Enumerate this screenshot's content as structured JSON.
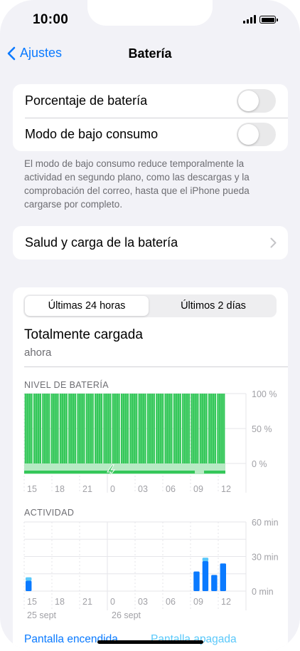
{
  "status": {
    "time": "10:00"
  },
  "nav": {
    "back_label": "Ajustes",
    "title": "Batería"
  },
  "settings": {
    "battery_percentage": {
      "label": "Porcentaje de batería",
      "on": false
    },
    "low_power": {
      "label": "Modo de bajo consumo",
      "on": false
    },
    "low_power_note": "El modo de bajo consumo reduce temporalmente la actividad en segundo plano, como las descargas y la comprobación del correo, hasta que el iPhone pueda cargarse por completo.",
    "health": {
      "label": "Salud y carga de la batería"
    }
  },
  "usage": {
    "tabs": [
      {
        "label": "Últimas 24 horas",
        "selected": true
      },
      {
        "label": "Últimos 2 días",
        "selected": false
      }
    ],
    "charge_status": "Totalmente cargada",
    "charge_time": "ahora",
    "battery_level_label": "NIVEL DE BATERÍA",
    "activity_label": "ACTIVIDAD",
    "dates": [
      "25 sept",
      "26 sept"
    ],
    "legend": {
      "screen_on": "Pantalla encendida",
      "screen_off": "Pantalla apagada"
    }
  },
  "colors": {
    "accent": "#0a7aff",
    "battery_green": "#34c759",
    "charging_green": "#b7eac4",
    "activity_dark": "#0a7aff",
    "activity_light": "#5ac8fa"
  },
  "chart_data": [
    {
      "type": "bar",
      "title": "NIVEL DE BATERÍA",
      "x_ticks": [
        "15",
        "18",
        "21",
        "0",
        "03",
        "06",
        "09",
        "12"
      ],
      "y_ticks": [
        "100 %",
        "50 %",
        "0 %"
      ],
      "ylim": [
        0,
        100
      ],
      "hour_count": 23,
      "values": [
        100,
        100,
        100,
        100,
        100,
        100,
        100,
        100,
        100,
        100,
        100,
        100,
        100,
        100,
        100,
        100,
        100,
        100,
        100,
        100,
        100,
        100,
        100
      ],
      "grid": true
    },
    {
      "type": "bar",
      "title": "ACTIVIDAD",
      "x_ticks": [
        "15",
        "18",
        "21",
        "0",
        "03",
        "06",
        "09",
        "12"
      ],
      "y_ticks": [
        "60 min",
        "30 min",
        "0 min"
      ],
      "ylim": [
        0,
        60
      ],
      "series": [
        {
          "name": "Pantalla encendida",
          "values": [
            9,
            0,
            0,
            0,
            0,
            0,
            0,
            0,
            0,
            0,
            0,
            0,
            0,
            0,
            0,
            0,
            0,
            0,
            0,
            17,
            26,
            14,
            24
          ]
        },
        {
          "name": "Pantalla apagada",
          "values": [
            3,
            0,
            0,
            0,
            0,
            0,
            0,
            0,
            0,
            0,
            0,
            0,
            0,
            0,
            0,
            0,
            0,
            0,
            0,
            0,
            3,
            0,
            0
          ]
        }
      ],
      "grid": true
    }
  ]
}
